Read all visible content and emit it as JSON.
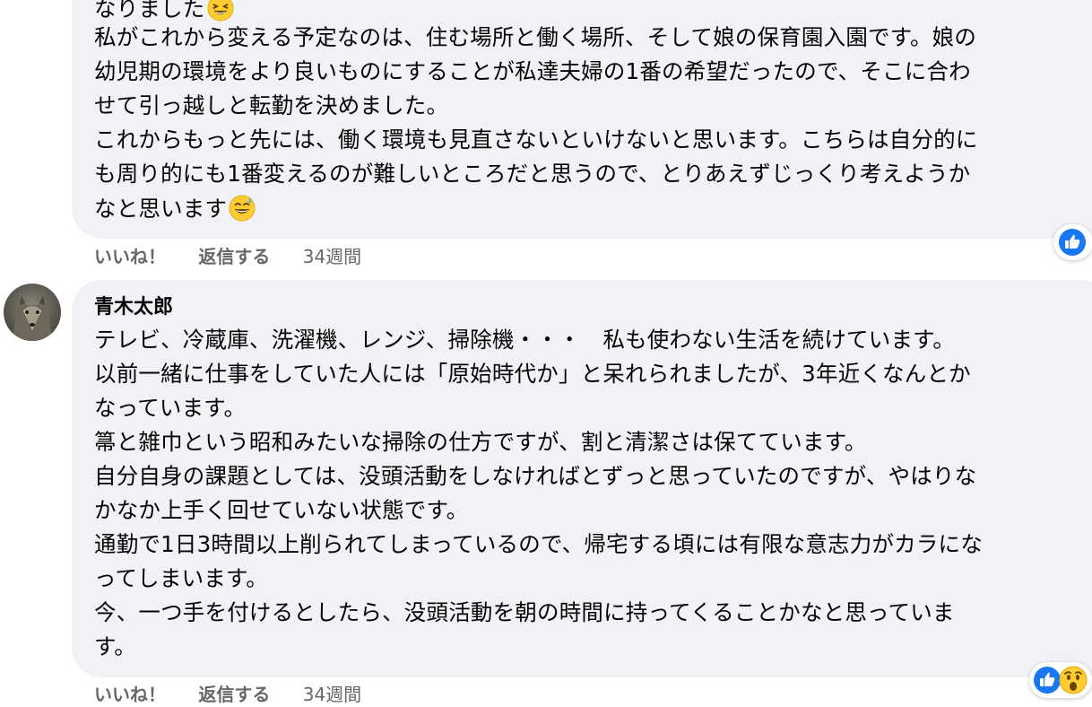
{
  "colors": {
    "bubble_bg": "#f0f2f5",
    "text": "#050505",
    "meta_text": "#65676b",
    "like_blue": "#1877f2"
  },
  "comment1": {
    "lines": [
      "なりました",
      "私がこれから変える予定なのは、住む場所と働く場所、そして娘の保育園入園です。娘の",
      "幼児期の環境をより良いものにすることが私達夫婦の1番の希望だったので、そこに合わ",
      "せて引っ越しと転勤を決めました。",
      "これからもっと先には、働く環境も見直さないといけないと思います。こちらは自分的に",
      "も周り的にも1番変えるのが難しいところだと思うので、とりあえずじっくり考えようか",
      "なと思います"
    ],
    "emojis": [
      "grinning-squinting-emoji",
      "grinning-sweat-emoji"
    ],
    "actions": {
      "like_label": "いいね！",
      "reply_label": "返信する",
      "timestamp": "34週間"
    },
    "reactions": [
      "like-icon"
    ]
  },
  "comment2": {
    "author": "青木太郎",
    "avatar_icon": "wolf-avatar",
    "lines": [
      "テレビ、冷蔵庫、洗濯機、レンジ、掃除機・・・　私も使わない生活を続けています。",
      "以前一緒に仕事をしていた人には「原始時代か」と呆れられましたが、3年近くなんとか",
      "なっています。",
      "箒と雑巾という昭和みたいな掃除の仕方ですが、割と清潔さは保てています。",
      "自分自身の課題としては、没頭活動をしなければとずっと思っていたのですが、やはりな",
      "かなか上手く回せていない状態です。",
      "通勤で1日3時間以上削られてしまっているので、帰宅する頃には有限な意志力がカラにな",
      "ってしまいます。",
      "今、一つ手を付けるとしたら、没頭活動を朝の時間に持ってくることかなと思っていま",
      "す。"
    ],
    "actions": {
      "like_label": "いいね！",
      "reply_label": "返信する",
      "timestamp": "34週間"
    },
    "reactions": [
      "like-icon",
      "wow-icon"
    ]
  }
}
